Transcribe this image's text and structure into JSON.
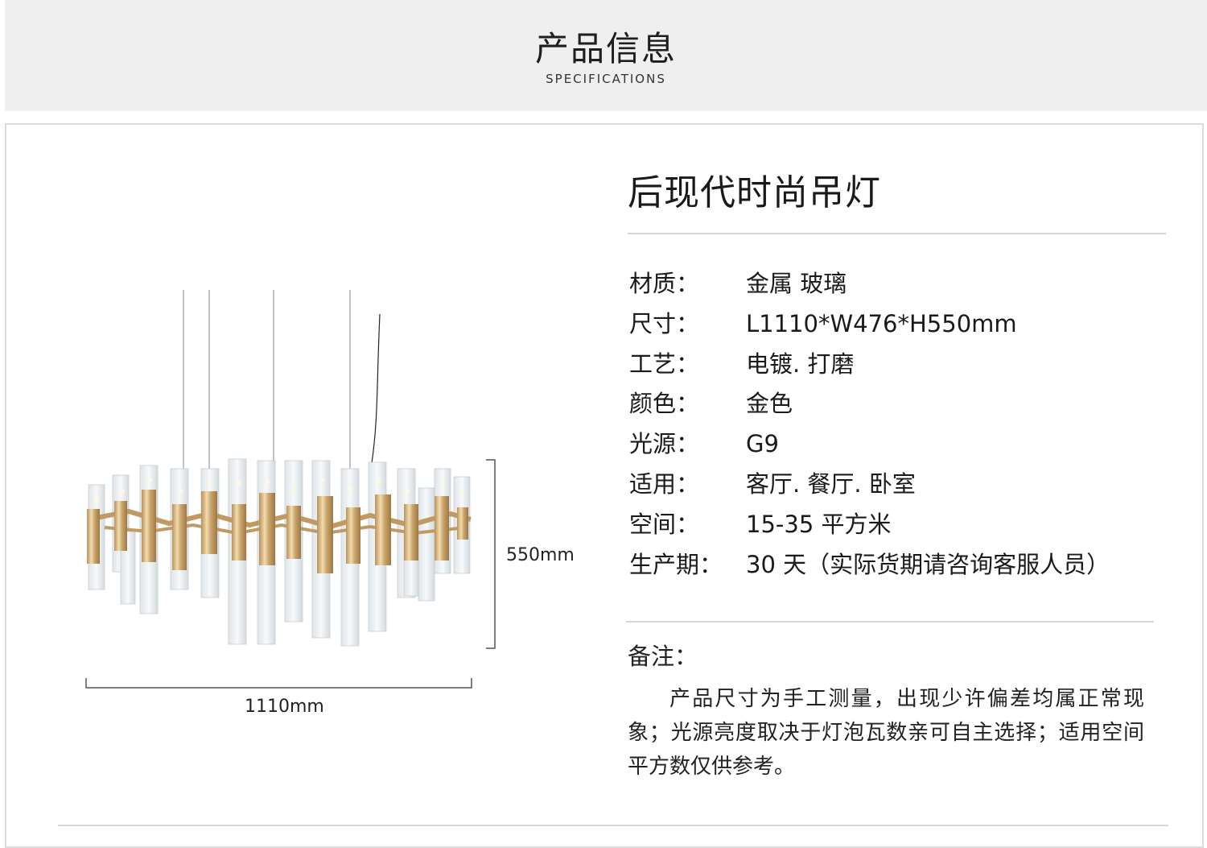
{
  "header": {
    "title": "产品信息",
    "subtitle": "SPECIFICATIONS"
  },
  "product": {
    "title": "后现代时尚吊灯"
  },
  "specs": [
    {
      "label": "材质：",
      "value": "金属 玻璃"
    },
    {
      "label": "尺寸：",
      "value": "L1110*W476*H550mm"
    },
    {
      "label": "工艺：",
      "value": "电镀. 打磨"
    },
    {
      "label": "颜色：",
      "value": "金色"
    },
    {
      "label": "光源：",
      "value": "G9"
    },
    {
      "label": "适用：",
      "value": "客厅. 餐厅. 卧室"
    },
    {
      "label": "空间：",
      "value": "15-35 平方米"
    },
    {
      "label": "生产期：",
      "value": "30 天（实际货期请咨询客服人员）"
    }
  ],
  "note": {
    "title": "备注：",
    "text": "产品尺寸为手工测量，出现少许偏差均属正常现象；光源亮度取决于灯泡瓦数亲可自主选择；适用空间平方数仅供参考。"
  },
  "dimensions": {
    "height_label": "550mm",
    "width_label": "1110mm"
  },
  "colors": {
    "header_bg": "#efefef",
    "gold": "#c9a56b",
    "glass": "#e9edf0",
    "rule": "#d6d6d6"
  }
}
